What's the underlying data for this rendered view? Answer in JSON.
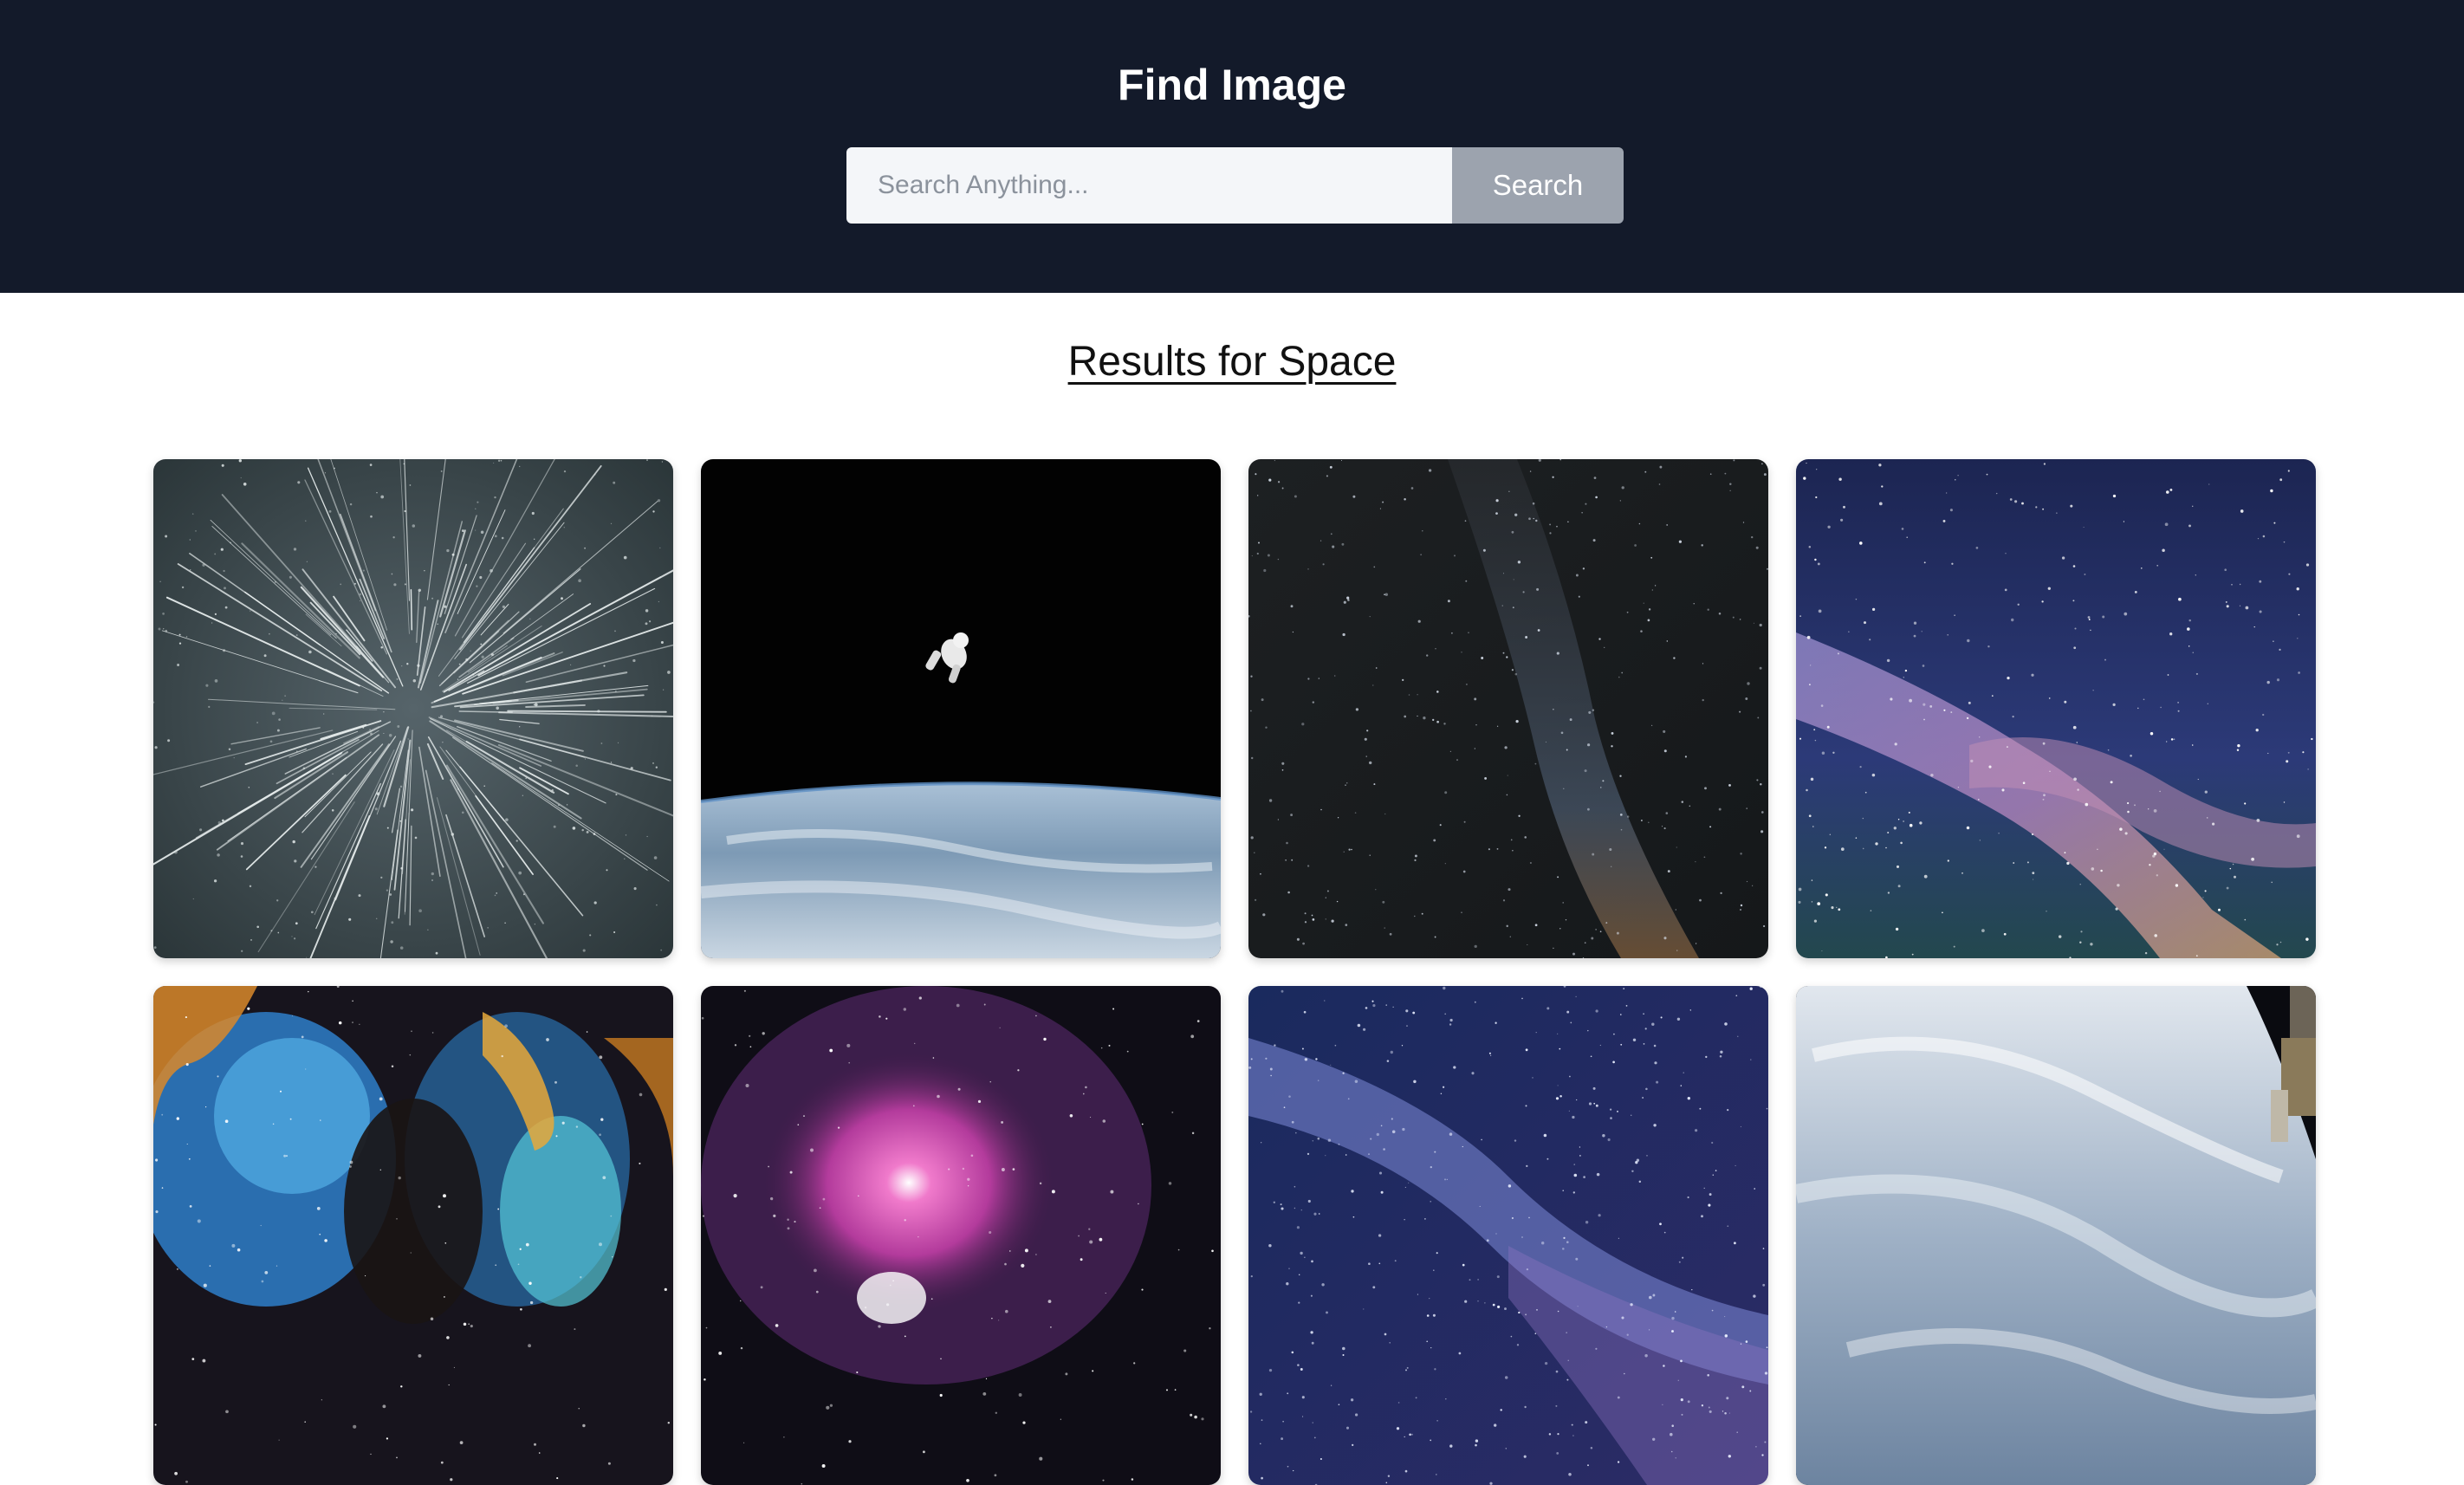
{
  "header": {
    "title": "Find Image",
    "search_placeholder": "Search Anything...",
    "search_value": "",
    "search_button_label": "Search",
    "background_color": "#131a2a"
  },
  "results": {
    "heading": "Results for Space",
    "images": [
      {
        "name": "star-warp-image",
        "theme": "starfield warp streaks"
      },
      {
        "name": "astronaut-earth-image",
        "theme": "astronaut floating above earth"
      },
      {
        "name": "milky-way-dark-image",
        "theme": "dark milky way"
      },
      {
        "name": "milky-way-blue-image",
        "theme": "blue purple milky way"
      },
      {
        "name": "nebula-colorful-image",
        "theme": "orange blue nebula"
      },
      {
        "name": "orion-nebula-image",
        "theme": "pink orion nebula"
      },
      {
        "name": "blue-galaxy-image",
        "theme": "blue galaxy stars"
      },
      {
        "name": "earth-orbit-image",
        "theme": "earth from space station"
      }
    ]
  }
}
